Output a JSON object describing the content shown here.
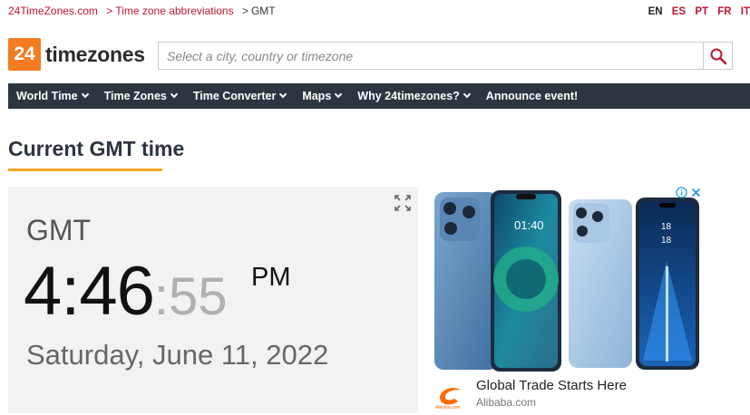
{
  "breadcrumb": {
    "items": [
      "24TimeZones.com",
      "Time zone abbreviations",
      "GMT"
    ],
    "separator": ">"
  },
  "languages": [
    "EN",
    "ES",
    "PT",
    "FR",
    "IT"
  ],
  "logo": {
    "number": "24",
    "text": "timezones",
    "accent": "#f47b20"
  },
  "search": {
    "placeholder": "Select a city, country or timezone",
    "icon": "search-icon"
  },
  "nav": {
    "items": [
      {
        "label": "World Time",
        "dropdown": true
      },
      {
        "label": "Time Zones",
        "dropdown": true
      },
      {
        "label": "Time Converter",
        "dropdown": true
      },
      {
        "label": "Maps",
        "dropdown": true
      },
      {
        "label": "Why 24timezones?",
        "dropdown": true
      },
      {
        "label": "Announce event!",
        "dropdown": false
      }
    ],
    "background": "#2d3540"
  },
  "page_title": "Current GMT time",
  "clock": {
    "zone": "GMT",
    "hours_minutes": "4:46",
    "seconds": ":55",
    "ampm": "PM",
    "date": "Saturday, June 11, 2022"
  },
  "ad": {
    "headline": "Global Trade Starts Here",
    "domain": "Alibaba.com",
    "logo_text": "Alibaba.com",
    "phone_time": "01:40",
    "phone_date": "18\n18"
  },
  "colors": {
    "link": "#c0152f",
    "title_underline": "#f5a623"
  }
}
